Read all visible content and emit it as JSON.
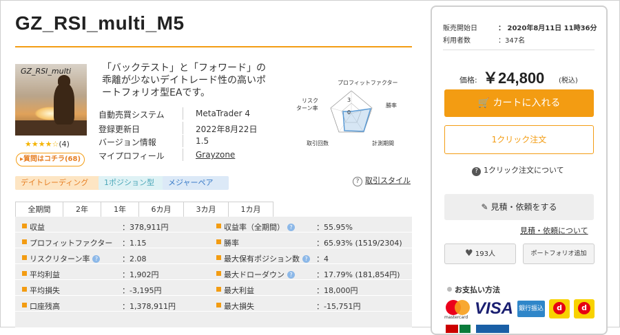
{
  "product": {
    "title": "GZ_RSI_multi_M5",
    "thumb_caption": "GZ_RSI_multi",
    "rating_stars": "★★★★☆",
    "rating_count": "(4)",
    "question_label": "質問はコチラ(68)",
    "description": "「バックテスト」と「フォワード」の乖離が少ないデイトレード性の高いポートフォリオ型EAです。"
  },
  "details": [
    {
      "label": "自動売買システム",
      "value": "MetaTrader 4"
    },
    {
      "label": "登録更新日",
      "value": "2022年8月22日"
    },
    {
      "label": "バージョン情報",
      "value": "1.5"
    },
    {
      "label": "マイプロフィール",
      "value": "Grayzone"
    }
  ],
  "radar": {
    "labels": [
      "プロフィットファクター",
      "勝率",
      "計測期間",
      "取引回数",
      "リスク",
      "ターン率"
    ],
    "scale_max": "3",
    "scale_min": "0"
  },
  "tags": [
    "デイトレーディング",
    "1ポジション型",
    "メジャーペア"
  ],
  "trade_style_link": "取引スタイル",
  "period_tabs": [
    "全期間",
    "2年",
    "1年",
    "6カ月",
    "3カ月",
    "1カ月"
  ],
  "stats_left": [
    {
      "label": "収益",
      "value": "：378,911円"
    },
    {
      "label": "プロフィットファクター",
      "value": "：1.15"
    },
    {
      "label": "リスクリターン率",
      "value": "：2.08"
    },
    {
      "label": "平均利益",
      "value": "：1,902円"
    },
    {
      "label": "平均損失",
      "value": "：-3,195円"
    },
    {
      "label": "口座残高",
      "value": "：1,378,911円"
    }
  ],
  "stats_right": [
    {
      "label": "収益率（全期間）",
      "value": "：55.95%"
    },
    {
      "label": "勝率",
      "value": "：65.93% (1519/2304)"
    },
    {
      "label": "最大保有ポジション数",
      "value": "：4"
    },
    {
      "label": "最大ドローダウン",
      "value": "：17.79% (181,854円)"
    },
    {
      "label": "最大利益",
      "value": "：18,000円"
    },
    {
      "label": "最大損失",
      "value": "：-15,751円"
    }
  ],
  "sidebar": {
    "sale_start_label": "販売開始日",
    "sale_start_value": "：  2020年8月11日 11時36分",
    "users_label": "利用者数",
    "users_value": "：347名",
    "price_label": "価格:",
    "price": "￥24,800",
    "tax": "(税込)",
    "cart_button": "カートに入れる",
    "oneclick_button": "1クリック注文",
    "oneclick_help": "1クリック注文について",
    "quote_button": "見積・依頼をする",
    "quote_link": "見積・依頼について",
    "fav_count": "193人",
    "portfolio_button": "ポートフォリオ追加",
    "payment_title": "お支払い方法",
    "mastercard": "mastercard",
    "visa": "VISA",
    "bank": "銀行振込"
  },
  "colors": {
    "accent": "#f39c12",
    "stats_bg": "#eeeeee"
  }
}
